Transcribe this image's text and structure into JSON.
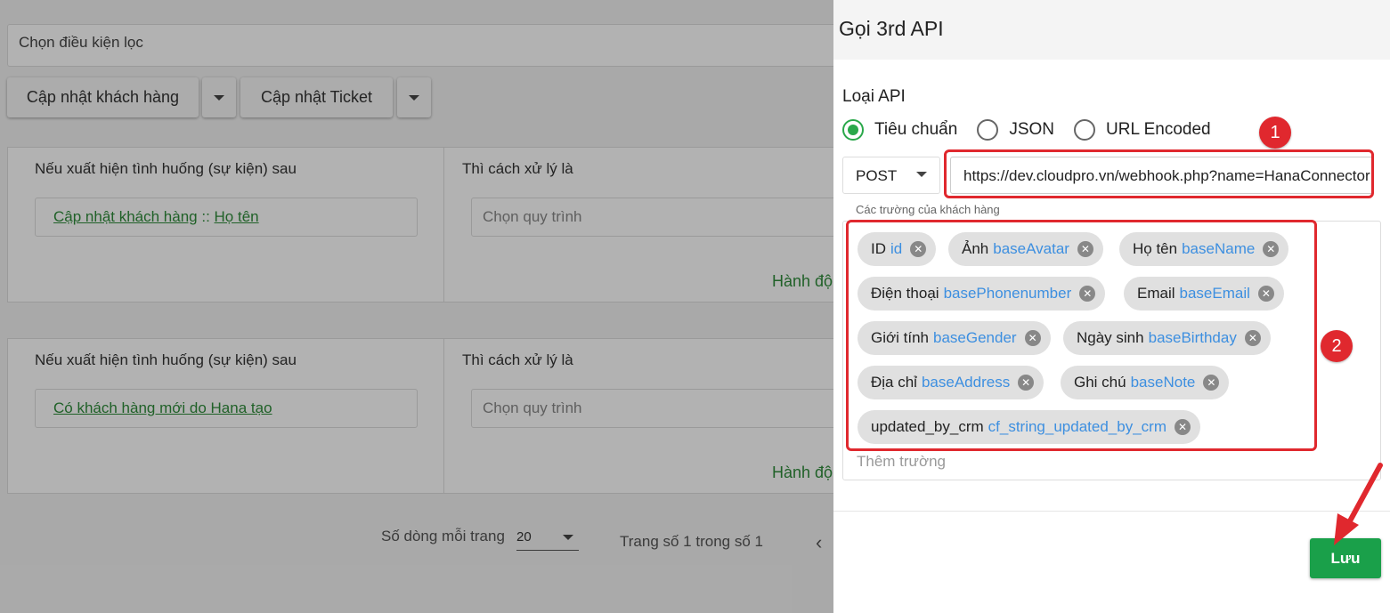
{
  "background": {
    "filter_placeholder": "Chọn điều kiện lọc",
    "buttons": {
      "update_customer": "Cập nhật khách hàng",
      "update_ticket": "Cập nhật Ticket"
    },
    "rules": [
      {
        "event_label": "Nếu xuất hiện tình huống (sự kiện) sau",
        "event_name": "Cập nhật khách hàng",
        "event_sep": " :: ",
        "event_field": "Họ tên",
        "handler_label": "Thì cách xử lý là",
        "handler_placeholder": "Chọn quy trình",
        "action_link": "Hành độ"
      },
      {
        "event_label": "Nếu xuất hiện tình huống (sự kiện) sau",
        "event_name": "Có khách hàng mới do Hana tạo",
        "handler_label": "Thì cách xử lý là",
        "handler_placeholder": "Chọn quy trình",
        "action_link": "Hành độ"
      }
    ],
    "pager": {
      "rows_label": "Số dòng mỗi trang",
      "rows_value": "20",
      "page_info": "Trang số 1 trong số 1",
      "prev": "‹"
    }
  },
  "drawer": {
    "title": "Gọi 3rd API",
    "api_type_label": "Loại API",
    "api_types": [
      {
        "label": "Tiêu chuẩn",
        "selected": true
      },
      {
        "label": "JSON",
        "selected": false
      },
      {
        "label": "URL Encoded",
        "selected": false
      }
    ],
    "method": "POST",
    "url": "https://dev.cloudpro.vn/webhook.php?name=HanaConnector",
    "fields_caption": "Các trường của khách hàng",
    "fields": [
      {
        "label": "ID",
        "key": "id"
      },
      {
        "label": "Ảnh",
        "key": "baseAvatar"
      },
      {
        "label": "Họ tên",
        "key": "baseName"
      },
      {
        "label": "Điện thoại",
        "key": "basePhonenumber"
      },
      {
        "label": "Email",
        "key": "baseEmail"
      },
      {
        "label": "Giới tính",
        "key": "baseGender"
      },
      {
        "label": "Ngày sinh",
        "key": "baseBirthday"
      },
      {
        "label": "Địa chỉ",
        "key": "baseAddress"
      },
      {
        "label": "Ghi chú",
        "key": "baseNote"
      },
      {
        "label": "updated_by_crm",
        "key": "cf_string_updated_by_crm"
      }
    ],
    "add_field_placeholder": "Thêm trường",
    "save_label": "Lưu"
  },
  "annotations": {
    "badge_1": "1",
    "badge_2": "2"
  },
  "colors": {
    "accent_green": "#1aa04a",
    "link_green": "#2e8b3a",
    "field_key_blue": "#3d8fe0",
    "annotation_red": "#e0282e"
  }
}
